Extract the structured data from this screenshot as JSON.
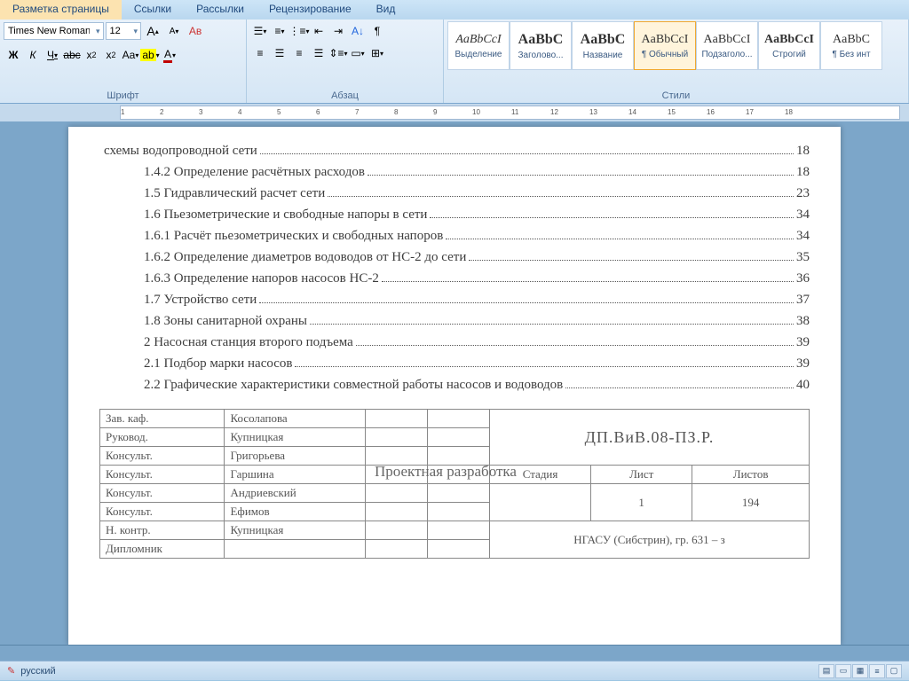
{
  "ribbon_tabs": {
    "t0": "Разметка страницы",
    "t1": "Ссылки",
    "t2": "Рассылки",
    "t3": "Рецензирование",
    "t4": "Вид"
  },
  "font": {
    "name": "Times New Roman",
    "size": "12",
    "group_label": "Шрифт"
  },
  "para": {
    "group_label": "Абзац"
  },
  "styles": {
    "group_label": "Стили",
    "preview": "AaBbCcI",
    "preview_serif_big": "AaBbC",
    "s0": "Выделение",
    "s1": "Заголово...",
    "s2": "Название",
    "s3": "¶ Обычный",
    "s4": "Подзаголо...",
    "s5": "Строгий",
    "s6": "¶ Без инт"
  },
  "toc": [
    {
      "indent": 0,
      "text": "схемы водопроводной сети",
      "page": "18"
    },
    {
      "indent": 1,
      "text": "1.4.2 Определение расчётных расходов",
      "page": "18"
    },
    {
      "indent": 1,
      "text": "1.5 Гидравлический расчет сети",
      "page": "23"
    },
    {
      "indent": 1,
      "text": "1.6 Пьезометрические и свободные напоры в сети",
      "page": "34"
    },
    {
      "indent": 1,
      "text": "1.6.1 Расчёт пьезометрических и свободных напоров",
      "page": "34"
    },
    {
      "indent": 1,
      "text": "1.6.2 Определение диаметров водоводов от НС-2 до сети",
      "page": "35"
    },
    {
      "indent": 1,
      "text": "1.6.3 Определение напоров насосов НС-2",
      "page": "36"
    },
    {
      "indent": 1,
      "text": "1.7 Устройство сети",
      "page": "37"
    },
    {
      "indent": 1,
      "text": "1.8 Зоны санитарной охраны",
      "page": "38"
    },
    {
      "indent": 1,
      "text": "2 Насосная станция второго подъема",
      "page": "39"
    },
    {
      "indent": 1,
      "text": "2.1 Подбор марки насосов",
      "page": "39"
    },
    {
      "indent": 1,
      "text": "2.2 Графические характеристики совместной работы насосов и водоводов",
      "page": "40"
    }
  ],
  "stamp": {
    "roles": {
      "r0": "Зав. каф.",
      "n0": "Косолапова",
      "r1": "Руковод.",
      "n1": "Купницкая",
      "r2": "Консульт.",
      "n2": "Григорьева",
      "r3": "Консульт.",
      "n3": "Гаршина",
      "r4": "Консульт.",
      "n4": "Андриевский",
      "r5": "Консульт.",
      "n5": "Ефимов",
      "r6": "Н. контр.",
      "n6": "Купницкая",
      "r7": "Дипломник",
      "n7": ""
    },
    "doc_code": "ДП.ВиВ.08-ПЗ.Р.",
    "title": "Проектная разработка",
    "stage_h": "Стадия",
    "sheet_h": "Лист",
    "sheets_h": "Листов",
    "stage": "",
    "sheet": "1",
    "sheets": "194",
    "org": "НГАСУ (Сибстрин), гр. 631 – з"
  },
  "status": {
    "lang": "русский"
  },
  "ruler_labels": [
    "1",
    "2",
    "3",
    "4",
    "5",
    "6",
    "7",
    "8",
    "9",
    "10",
    "11",
    "12",
    "13",
    "14",
    "15",
    "16",
    "17",
    "18"
  ]
}
